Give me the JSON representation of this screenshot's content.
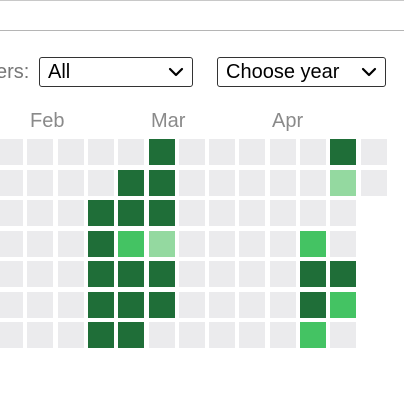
{
  "filters": {
    "user_label": "ers:",
    "user_selected": "All",
    "year_selected": "Choose year",
    "chevron_icon": "chevron-down-icon"
  },
  "months": [
    "Feb",
    "Mar",
    "Apr"
  ],
  "colors": {
    "empty": "#ebebed",
    "level1": "#94d9a0",
    "level2": "#44c363",
    "level3": "#1f6e38"
  },
  "heatmap": {
    "week_columns": 13,
    "day_rows": 7,
    "levels": [
      [
        0,
        0,
        0,
        0,
        0,
        3,
        0,
        0,
        0,
        0,
        0,
        3,
        0
      ],
      [
        0,
        0,
        0,
        0,
        3,
        3,
        0,
        0,
        0,
        0,
        0,
        1,
        0
      ],
      [
        0,
        0,
        0,
        3,
        3,
        3,
        0,
        0,
        0,
        0,
        0,
        0,
        null
      ],
      [
        0,
        0,
        0,
        3,
        2,
        1,
        0,
        0,
        0,
        0,
        2,
        0,
        null
      ],
      [
        0,
        0,
        0,
        3,
        3,
        3,
        0,
        0,
        0,
        0,
        3,
        3,
        null
      ],
      [
        0,
        0,
        0,
        3,
        3,
        3,
        0,
        0,
        0,
        0,
        3,
        2,
        null
      ],
      [
        0,
        0,
        0,
        3,
        3,
        0,
        0,
        0,
        0,
        0,
        2,
        0,
        null
      ]
    ]
  }
}
